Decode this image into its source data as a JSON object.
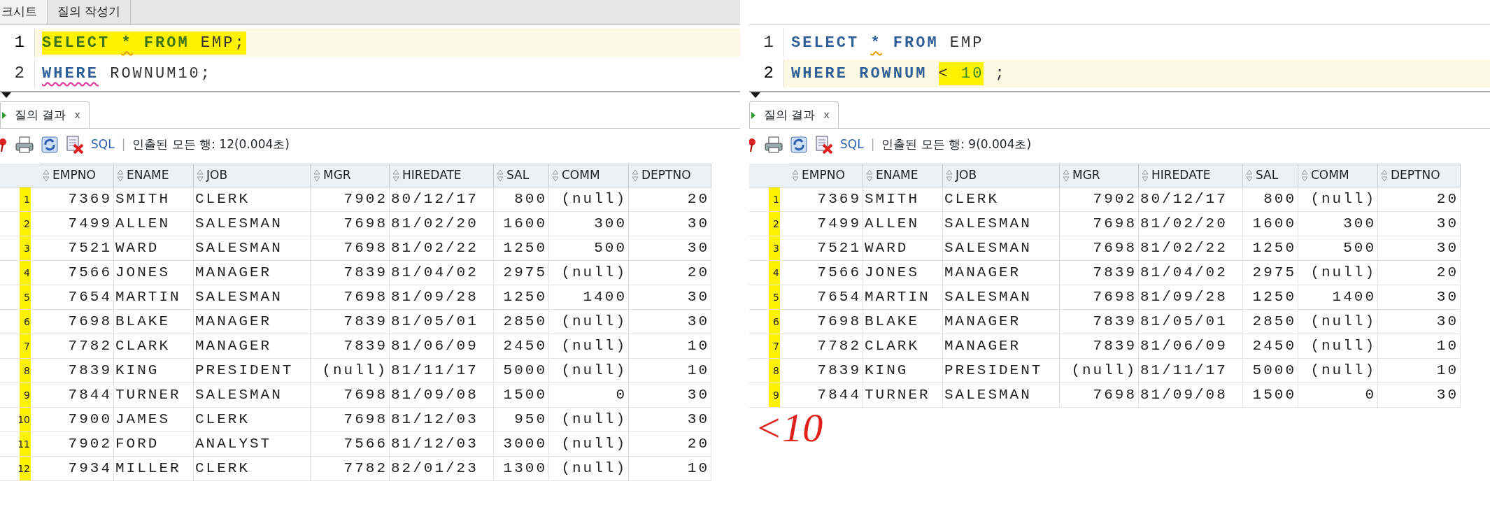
{
  "panels": [
    {
      "tabs": [
        {
          "label": "크시트",
          "selected": true
        },
        {
          "label": "질의 작성기",
          "selected": false
        }
      ],
      "editor": {
        "lines": [
          {
            "number": "1",
            "current": true,
            "tokens": [
              {
                "text": "SELECT",
                "kind": "keyword",
                "highlighted": true
              },
              {
                "text": "*",
                "kind": "keyword",
                "highlighted": true,
                "warned": true
              },
              {
                "text": "FROM",
                "kind": "keyword",
                "highlighted": true
              },
              {
                "text": "EMP;",
                "kind": "plain",
                "highlighted": true
              }
            ]
          },
          {
            "number": "2",
            "current": false,
            "tokens": [
              {
                "text": "WHERE",
                "kind": "keyword",
                "highlighted": false,
                "misspelled": true
              },
              {
                "text": "ROWNUM10;",
                "kind": "plain",
                "highlighted": false
              }
            ]
          }
        ]
      },
      "results_tab": {
        "label": "질의 결과",
        "close": "x"
      },
      "toolbar": {
        "sql": "SQL",
        "separator": "|",
        "status": "인출된 모든 행: 12(0.004초)"
      },
      "table": {
        "columns": [
          {
            "label": "EMPNO",
            "kind": "numeric"
          },
          {
            "label": "ENAME",
            "kind": "text"
          },
          {
            "label": "JOB",
            "kind": "text"
          },
          {
            "label": "MGR",
            "kind": "numeric"
          },
          {
            "label": "HIREDATE",
            "kind": "text"
          },
          {
            "label": "SAL",
            "kind": "numeric"
          },
          {
            "label": "COMM",
            "kind": "numeric"
          },
          {
            "label": "DEPTNO",
            "kind": "numeric"
          }
        ],
        "rows": [
          {
            "number": "1",
            "marked": true,
            "cells": [
              "7369",
              "SMITH",
              "CLERK",
              "7902",
              "80/12/17",
              "800",
              "(null)",
              "20"
            ]
          },
          {
            "number": "2",
            "marked": true,
            "cells": [
              "7499",
              "ALLEN",
              "SALESMAN",
              "7698",
              "81/02/20",
              "1600",
              "300",
              "30"
            ]
          },
          {
            "number": "3",
            "marked": true,
            "cells": [
              "7521",
              "WARD",
              "SALESMAN",
              "7698",
              "81/02/22",
              "1250",
              "500",
              "30"
            ]
          },
          {
            "number": "4",
            "marked": true,
            "cells": [
              "7566",
              "JONES",
              "MANAGER",
              "7839",
              "81/04/02",
              "2975",
              "(null)",
              "20"
            ]
          },
          {
            "number": "5",
            "marked": true,
            "cells": [
              "7654",
              "MARTIN",
              "SALESMAN",
              "7698",
              "81/09/28",
              "1250",
              "1400",
              "30"
            ]
          },
          {
            "number": "6",
            "marked": true,
            "cells": [
              "7698",
              "BLAKE",
              "MANAGER",
              "7839",
              "81/05/01",
              "2850",
              "(null)",
              "30"
            ]
          },
          {
            "number": "7",
            "marked": true,
            "cells": [
              "7782",
              "CLARK",
              "MANAGER",
              "7839",
              "81/06/09",
              "2450",
              "(null)",
              "10"
            ]
          },
          {
            "number": "8",
            "marked": true,
            "cells": [
              "7839",
              "KING",
              "PRESIDENT",
              "(null)",
              "81/11/17",
              "5000",
              "(null)",
              "10"
            ]
          },
          {
            "number": "9",
            "marked": true,
            "cells": [
              "7844",
              "TURNER",
              "SALESMAN",
              "7698",
              "81/09/08",
              "1500",
              "0",
              "30"
            ]
          },
          {
            "number": "10",
            "marked": true,
            "cells": [
              "7900",
              "JAMES",
              "CLERK",
              "7698",
              "81/12/03",
              "950",
              "(null)",
              "30"
            ]
          },
          {
            "number": "11",
            "marked": true,
            "cells": [
              "7902",
              "FORD",
              "ANALYST",
              "7566",
              "81/12/03",
              "3000",
              "(null)",
              "20"
            ]
          },
          {
            "number": "12",
            "marked": true,
            "cells": [
              "7934",
              "MILLER",
              "CLERK",
              "7782",
              "82/01/23",
              "1300",
              "(null)",
              "10"
            ]
          }
        ]
      }
    },
    {
      "editor": {
        "lines": [
          {
            "number": "1",
            "current": false,
            "tokens": [
              {
                "text": "SELECT",
                "kind": "keyword",
                "highlighted": false
              },
              {
                "text": "*",
                "kind": "keyword",
                "highlighted": false,
                "warned": true
              },
              {
                "text": "FROM",
                "kind": "keyword",
                "highlighted": false
              },
              {
                "text": "EMP",
                "kind": "plain",
                "highlighted": false
              }
            ]
          },
          {
            "number": "2",
            "current": true,
            "tokens": [
              {
                "text": "WHERE",
                "kind": "keyword",
                "highlighted": false
              },
              {
                "text": "ROWNUM",
                "kind": "keyword",
                "highlighted": false
              },
              {
                "text": "<",
                "kind": "plain",
                "highlighted": true
              },
              {
                "text": "10",
                "kind": "number",
                "highlighted": true
              },
              {
                "text": ";",
                "kind": "plain",
                "highlighted": false
              }
            ]
          }
        ]
      },
      "results_tab": {
        "label": "질의 결과",
        "close": "x"
      },
      "toolbar": {
        "sql": "SQL",
        "separator": "|",
        "status": "인출된 모든 행: 9(0.004초)"
      },
      "table": {
        "columns": [
          {
            "label": "EMPNO",
            "kind": "numeric"
          },
          {
            "label": "ENAME",
            "kind": "text"
          },
          {
            "label": "JOB",
            "kind": "text"
          },
          {
            "label": "MGR",
            "kind": "numeric"
          },
          {
            "label": "HIREDATE",
            "kind": "text"
          },
          {
            "label": "SAL",
            "kind": "numeric"
          },
          {
            "label": "COMM",
            "kind": "numeric"
          },
          {
            "label": "DEPTNO",
            "kind": "numeric"
          }
        ],
        "rows": [
          {
            "number": "1",
            "marked": true,
            "cells": [
              "7369",
              "SMITH",
              "CLERK",
              "7902",
              "80/12/17",
              "800",
              "(null)",
              "20"
            ]
          },
          {
            "number": "2",
            "marked": true,
            "cells": [
              "7499",
              "ALLEN",
              "SALESMAN",
              "7698",
              "81/02/20",
              "1600",
              "300",
              "30"
            ]
          },
          {
            "number": "3",
            "marked": true,
            "cells": [
              "7521",
              "WARD",
              "SALESMAN",
              "7698",
              "81/02/22",
              "1250",
              "500",
              "30"
            ]
          },
          {
            "number": "4",
            "marked": true,
            "cells": [
              "7566",
              "JONES",
              "MANAGER",
              "7839",
              "81/04/02",
              "2975",
              "(null)",
              "20"
            ]
          },
          {
            "number": "5",
            "marked": true,
            "cells": [
              "7654",
              "MARTIN",
              "SALESMAN",
              "7698",
              "81/09/28",
              "1250",
              "1400",
              "30"
            ]
          },
          {
            "number": "6",
            "marked": true,
            "cells": [
              "7698",
              "BLAKE",
              "MANAGER",
              "7839",
              "81/05/01",
              "2850",
              "(null)",
              "30"
            ]
          },
          {
            "number": "7",
            "marked": true,
            "cells": [
              "7782",
              "CLARK",
              "MANAGER",
              "7839",
              "81/06/09",
              "2450",
              "(null)",
              "10"
            ]
          },
          {
            "number": "8",
            "marked": true,
            "cells": [
              "7839",
              "KING",
              "PRESIDENT",
              "(null)",
              "81/11/17",
              "5000",
              "(null)",
              "10"
            ]
          },
          {
            "number": "9",
            "marked": true,
            "cells": [
              "7844",
              "TURNER",
              "SALESMAN",
              "7698",
              "81/09/08",
              "1500",
              "0",
              "30"
            ]
          }
        ]
      },
      "annotation": "<10"
    }
  ]
}
